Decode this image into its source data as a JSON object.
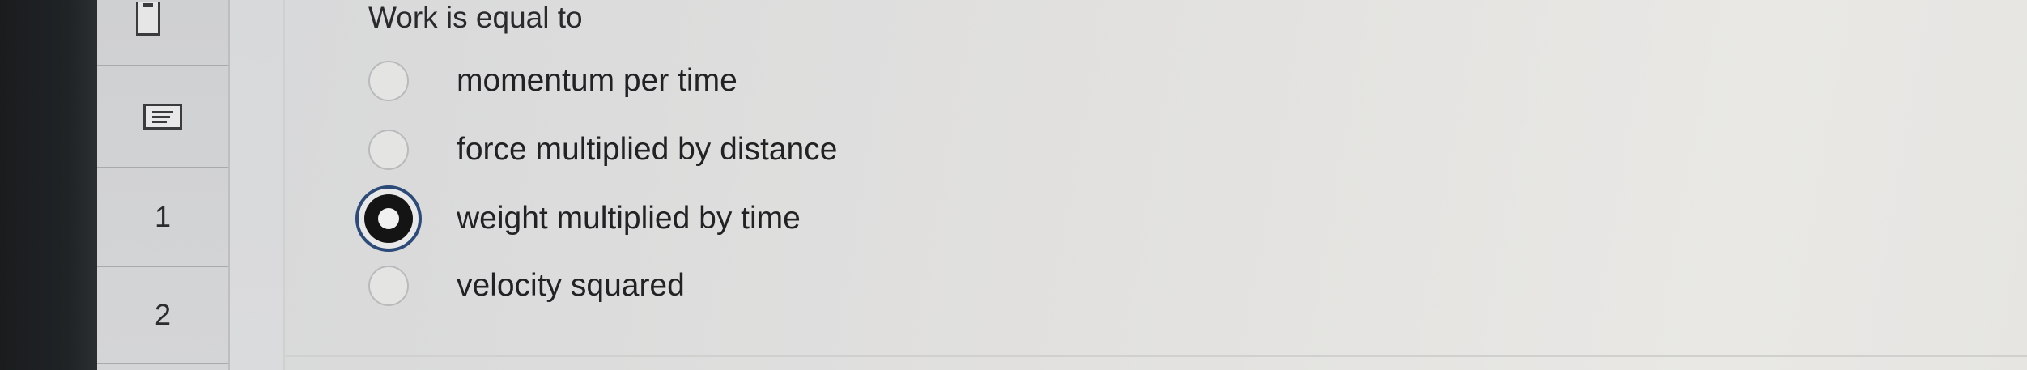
{
  "question": {
    "prompt": "Work is equal to",
    "options": [
      {
        "label": "momentum per time",
        "selected": false
      },
      {
        "label": "force multiplied by distance",
        "selected": false
      },
      {
        "label": "weight multiplied by time",
        "selected": true
      },
      {
        "label": "velocity squared",
        "selected": false
      }
    ]
  },
  "nav": {
    "flag_icon": "flag-icon",
    "list_icon": "list-icon",
    "items": [
      "1",
      "2"
    ]
  },
  "colors": {
    "selected_ring": "#2d4b78",
    "radio_fill": "#141414",
    "text": "#222224"
  }
}
